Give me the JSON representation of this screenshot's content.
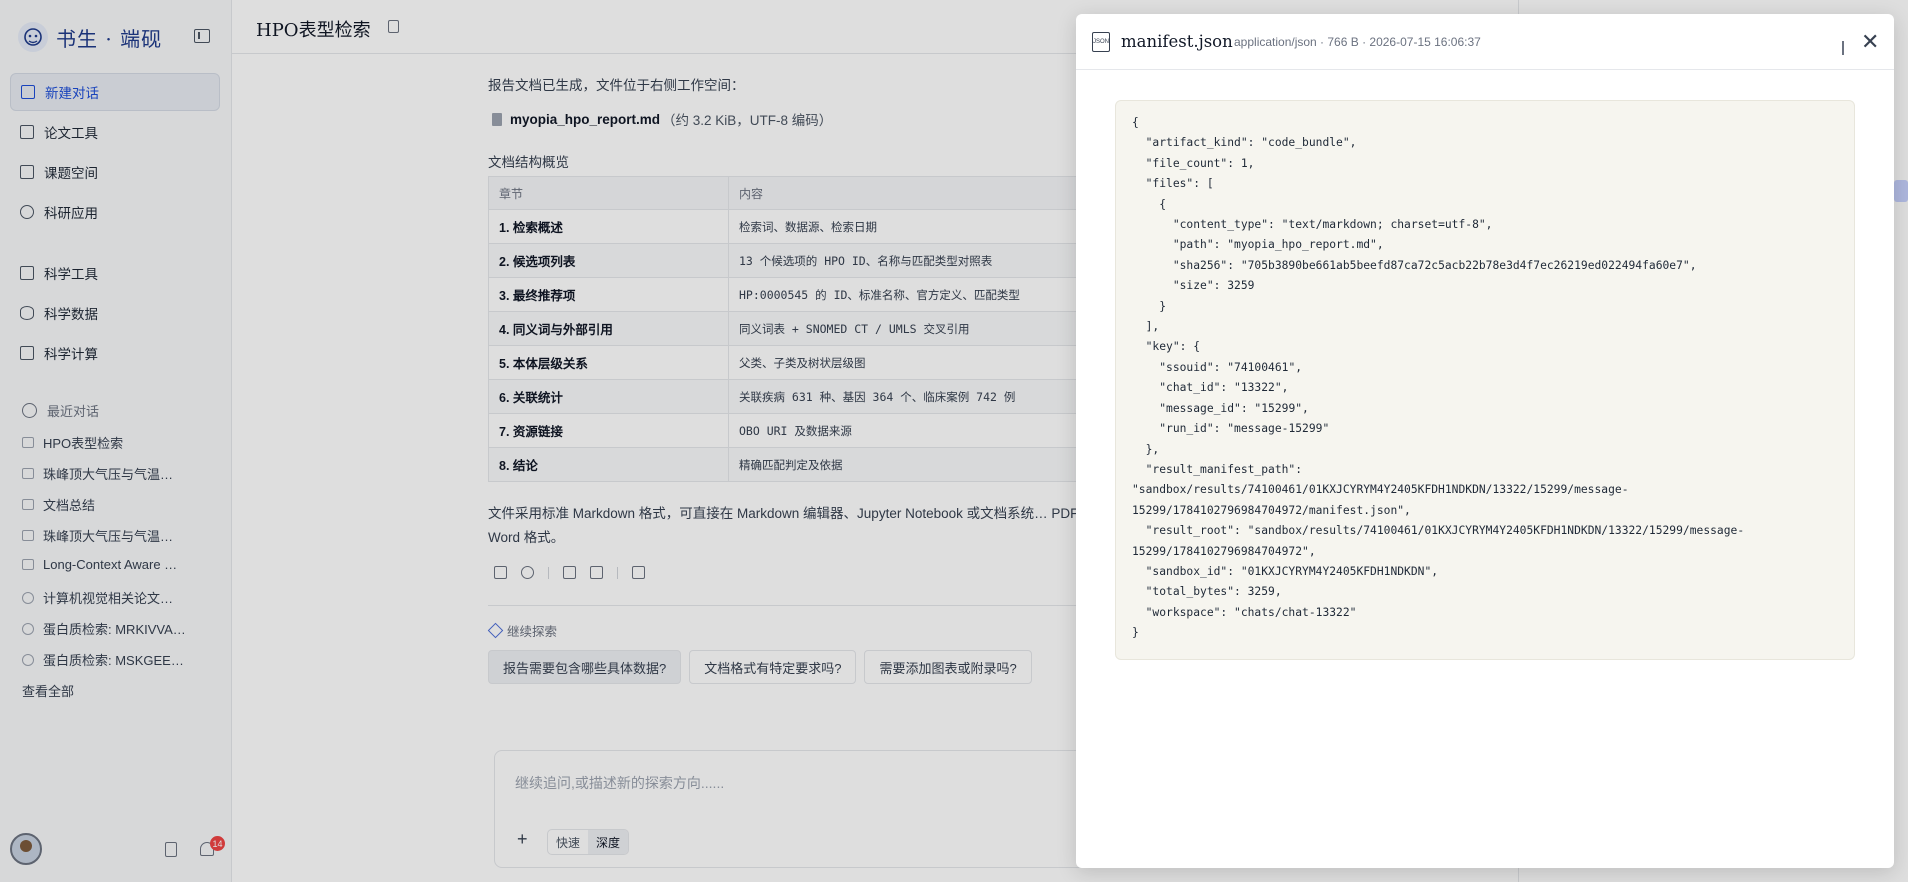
{
  "sidebar": {
    "brand": "书生 · 端砚",
    "nav": [
      {
        "label": "新建对话",
        "icon": "plus-square-icon"
      },
      {
        "label": "论文工具",
        "icon": "paper-icon"
      },
      {
        "label": "课题空间",
        "icon": "library-icon"
      },
      {
        "label": "科研应用",
        "icon": "hexagon-icon"
      },
      {
        "label": "科学工具",
        "icon": "toolbox-icon"
      },
      {
        "label": "科学数据",
        "icon": "database-icon"
      },
      {
        "label": "科学计算",
        "icon": "monitor-icon"
      }
    ],
    "recent_title": "最近对话",
    "recent": [
      "HPO表型检索",
      "珠峰顶大气压与气温…",
      "文档总结",
      "珠峰顶大气压与气温…",
      "Long-Context Aware …",
      "计算机视觉相关论文…",
      "蛋白质检索: MRKIVVA…",
      "蛋白质检索: MSKGEE…"
    ],
    "view_all": "查看全部",
    "notification_count": "14"
  },
  "main": {
    "title": "HPO表型检索",
    "intro": "报告文档已生成，文件位于右侧工作空间：",
    "file_name": "myopia_hpo_report.md",
    "file_info": "（约 3.2 KiB，UTF-8 编码）",
    "structure_title": "文档结构概览",
    "table": {
      "headers": [
        "章节",
        "内容"
      ],
      "rows": [
        [
          "1. 检索概述",
          "检索词、数据源、检索日期"
        ],
        [
          "2. 候选项列表",
          "13 个候选项的 HPO ID、名称与匹配类型对照表"
        ],
        [
          "3. 最终推荐项",
          "HP:0000545 的 ID、标准名称、官方定义、匹配类型"
        ],
        [
          "4. 同义词与外部引用",
          "同义词表 + SNOMED CT / UMLS 交叉引用"
        ],
        [
          "5. 本体层级关系",
          "父类、子类及树状层级图"
        ],
        [
          "6. 关联统计",
          "关联疾病 631 种、基因 364 个、临床案例 742 例"
        ],
        [
          "7. 资源链接",
          "OBO URI 及数据来源"
        ],
        [
          "8. 结论",
          "精确匹配判定及依据"
        ]
      ]
    },
    "paragraph": "文件采用标准 Markdown 格式，可直接在 Markdown 编辑器、Jupyter Notebook 或文档系统… PDF 或 Word 格式。",
    "explore_title": "继续探索",
    "chips": [
      "报告需要包含哪些具体数据?",
      "文档格式有特定要求吗?",
      "需要添加图表或附录吗?"
    ],
    "composer": {
      "placeholder": "继续追问,或描述新的探索方向......",
      "mode_fast": "快速",
      "mode_deep": "深度"
    }
  },
  "modal": {
    "icon_text": "JSON",
    "title": "manifest.json",
    "meta": "application/json · 766 B · 2026-07-15 16:06:37",
    "content": "{\n  \"artifact_kind\": \"code_bundle\",\n  \"file_count\": 1,\n  \"files\": [\n    {\n      \"content_type\": \"text/markdown; charset=utf-8\",\n      \"path\": \"myopia_hpo_report.md\",\n      \"sha256\": \"705b3890be661ab5beefd87ca72c5acb22b78e3d4f7ec26219ed022494fa60e7\",\n      \"size\": 3259\n    }\n  ],\n  \"key\": {\n    \"ssouid\": \"74100461\",\n    \"chat_id\": \"13322\",\n    \"message_id\": \"15299\",\n    \"run_id\": \"message-15299\"\n  },\n  \"result_manifest_path\":\n\"sandbox/results/74100461/01KXJCYRYM4Y2405KFDH1NDKDN/13322/15299/message-\n15299/1784102796984704972/manifest.json\",\n  \"result_root\": \"sandbox/results/74100461/01KXJCYRYM4Y2405KFDH1NDKDN/13322/15299/message-\n15299/1784102796984704972\",\n  \"sandbox_id\": \"01KXJCYRYM4Y2405KFDH1NDKDN\",\n  \"total_bytes\": 3259,\n  \"workspace\": \"chats/chat-13322\"\n}"
  }
}
